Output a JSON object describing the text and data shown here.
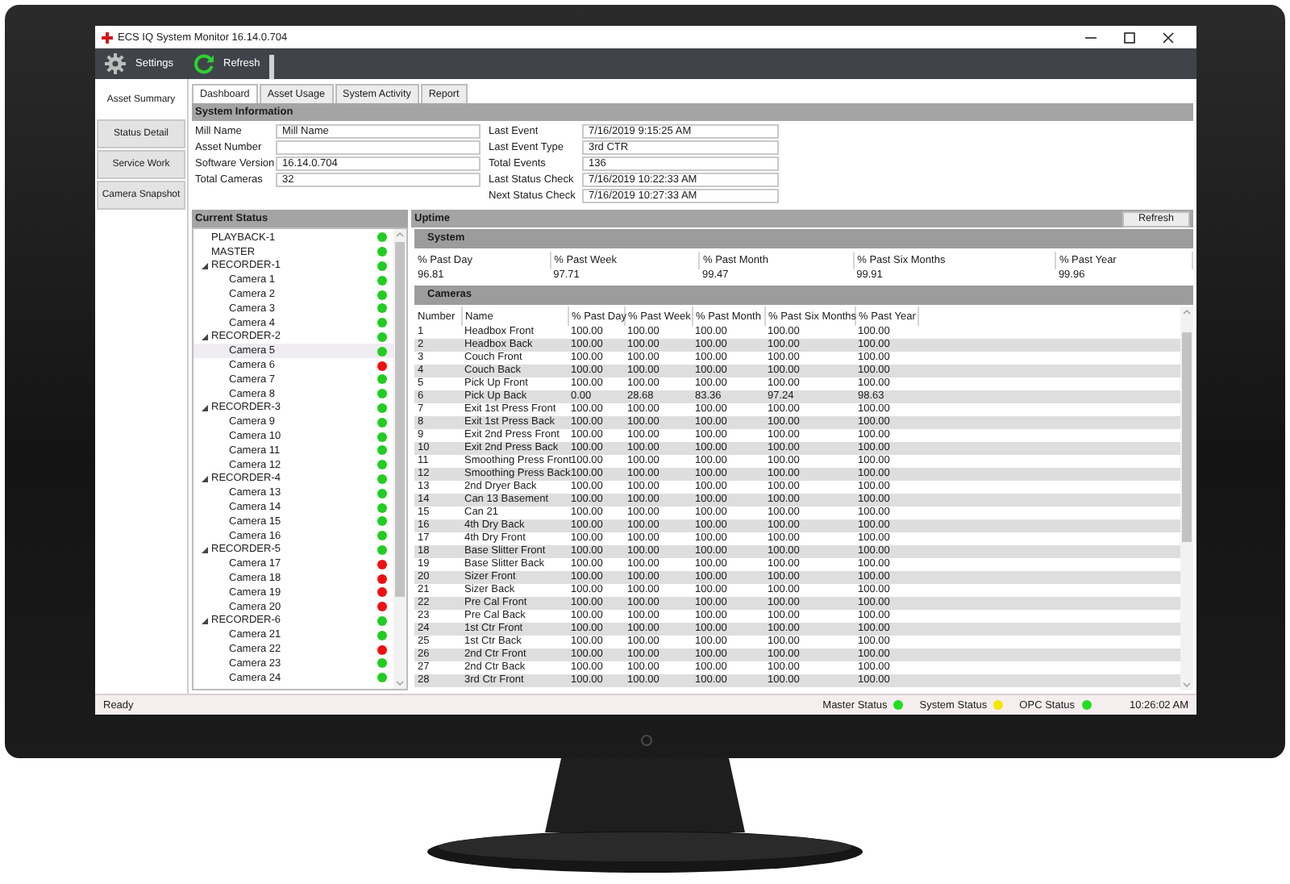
{
  "window": {
    "title": "ECS IQ System Monitor 16.14.0.704"
  },
  "toolbar": [
    {
      "label": "Settings",
      "kind": "settings"
    },
    {
      "label": "Refresh",
      "kind": "refresh"
    }
  ],
  "nav": [
    {
      "label": "Asset Summary",
      "selected": true
    },
    {
      "label": "Status Detail",
      "selected": false
    },
    {
      "label": "Service Work",
      "selected": false
    },
    {
      "label": "Camera Snapshot",
      "selected": false
    }
  ],
  "tabs": [
    {
      "label": "Dashboard",
      "selected": true
    },
    {
      "label": "Asset Usage",
      "selected": false
    },
    {
      "label": "System Activity",
      "selected": false
    },
    {
      "label": "Report",
      "selected": false
    }
  ],
  "system_information": {
    "title": "System Information",
    "fields_left": [
      {
        "label": "Mill Name",
        "value": "Mill Name"
      },
      {
        "label": "Asset Number"
      },
      {
        "label": "Software Version",
        "value": "16.14.0.704"
      },
      {
        "label": "Total Cameras",
        "value": "32"
      }
    ],
    "fields_right": [
      {
        "label": "Last Event",
        "value": "7/16/2019 9:15:25 AM"
      },
      {
        "label": "Last Event Type",
        "value": "3rd CTR"
      },
      {
        "label": "Total Events",
        "value": "136"
      },
      {
        "label": "Last Status Check",
        "value": "7/16/2019 10:22:33 AM"
      },
      {
        "label": "Next Status Check",
        "value": "7/16/2019 10:27:33 AM"
      }
    ]
  },
  "current_status": {
    "title": "Current Status",
    "items": [
      {
        "label": "PLAYBACK-1",
        "color": "#22cc22",
        "selected": false
      },
      {
        "label": "MASTER",
        "color": "#22cc22",
        "selected": false
      },
      {
        "label": "RECORDER-1",
        "color": "#22cc22",
        "selected": false,
        "expanded": true,
        "children": [
          {
            "label": "Camera 1",
            "color": "#22cc22",
            "selected": false
          },
          {
            "label": "Camera 2",
            "color": "#22cc22",
            "selected": false
          },
          {
            "label": "Camera 3",
            "color": "#22cc22",
            "selected": false
          },
          {
            "label": "Camera 4",
            "color": "#22cc22",
            "selected": false
          }
        ]
      },
      {
        "label": "RECORDER-2",
        "color": "#22cc22",
        "selected": false,
        "expanded": true,
        "children": [
          {
            "label": "Camera 5",
            "color": "#22cc22",
            "selected": true
          },
          {
            "label": "Camera 6",
            "color": "#ee1111",
            "selected": false
          },
          {
            "label": "Camera 7",
            "color": "#22cc22",
            "selected": false
          },
          {
            "label": "Camera 8",
            "color": "#22cc22",
            "selected": false
          }
        ]
      },
      {
        "label": "RECORDER-3",
        "color": "#22cc22",
        "selected": false,
        "expanded": true,
        "children": [
          {
            "label": "Camera 9",
            "color": "#22cc22",
            "selected": false
          },
          {
            "label": "Camera 10",
            "color": "#22cc22",
            "selected": false
          },
          {
            "label": "Camera 11",
            "color": "#22cc22",
            "selected": false
          },
          {
            "label": "Camera 12",
            "color": "#22cc22",
            "selected": false
          }
        ]
      },
      {
        "label": "RECORDER-4",
        "color": "#22cc22",
        "selected": false,
        "expanded": true,
        "children": [
          {
            "label": "Camera 13",
            "color": "#22cc22",
            "selected": false
          },
          {
            "label": "Camera 14",
            "color": "#22cc22",
            "selected": false
          },
          {
            "label": "Camera 15",
            "color": "#22cc22",
            "selected": false
          },
          {
            "label": "Camera 16",
            "color": "#22cc22",
            "selected": false
          }
        ]
      },
      {
        "label": "RECORDER-5",
        "color": "#22cc22",
        "selected": false,
        "expanded": true,
        "children": [
          {
            "label": "Camera 17",
            "color": "#ee1111",
            "selected": false
          },
          {
            "label": "Camera 18",
            "color": "#ee1111",
            "selected": false
          },
          {
            "label": "Camera 19",
            "color": "#ee1111",
            "selected": false
          },
          {
            "label": "Camera 20",
            "color": "#ee1111",
            "selected": false
          }
        ]
      },
      {
        "label": "RECORDER-6",
        "color": "#22cc22",
        "selected": false,
        "expanded": true,
        "children": [
          {
            "label": "Camera 21",
            "color": "#22cc22",
            "selected": false
          },
          {
            "label": "Camera 22",
            "color": "#ee1111",
            "selected": false
          },
          {
            "label": "Camera 23",
            "color": "#22cc22",
            "selected": false
          },
          {
            "label": "Camera 24",
            "color": "#22cc22",
            "selected": false
          }
        ]
      }
    ]
  },
  "uptime": {
    "title": "Uptime",
    "refresh_button": "Refresh",
    "system": {
      "title": "System",
      "columns": [
        "% Past Day",
        "% Past Week",
        "% Past Month",
        "% Past Six Months",
        "% Past Year"
      ],
      "row": [
        "96.81",
        "97.71",
        "99.47",
        "99.91",
        "99.96"
      ]
    },
    "cameras": {
      "title": "Cameras",
      "columns": [
        "Number",
        "Name",
        "% Past Day",
        "% Past Week",
        "% Past Month",
        "% Past Six Months",
        "% Past Year"
      ],
      "rows": [
        [
          "1",
          "Headbox Front",
          "100.00",
          "100.00",
          "100.00",
          "100.00",
          "100.00"
        ],
        [
          "2",
          "Headbox Back",
          "100.00",
          "100.00",
          "100.00",
          "100.00",
          "100.00"
        ],
        [
          "3",
          "Couch Front",
          "100.00",
          "100.00",
          "100.00",
          "100.00",
          "100.00"
        ],
        [
          "4",
          "Couch Back",
          "100.00",
          "100.00",
          "100.00",
          "100.00",
          "100.00"
        ],
        [
          "5",
          "Pick Up Front",
          "100.00",
          "100.00",
          "100.00",
          "100.00",
          "100.00"
        ],
        [
          "6",
          "Pick Up Back",
          "0.00",
          "28.68",
          "83.36",
          "97.24",
          "98.63"
        ],
        [
          "7",
          "Exit 1st Press Front",
          "100.00",
          "100.00",
          "100.00",
          "100.00",
          "100.00"
        ],
        [
          "8",
          "Exit 1st Press Back",
          "100.00",
          "100.00",
          "100.00",
          "100.00",
          "100.00"
        ],
        [
          "9",
          "Exit 2nd Press Front",
          "100.00",
          "100.00",
          "100.00",
          "100.00",
          "100.00"
        ],
        [
          "10",
          "Exit 2nd Press Back",
          "100.00",
          "100.00",
          "100.00",
          "100.00",
          "100.00"
        ],
        [
          "11",
          "Smoothing Press Front",
          "100.00",
          "100.00",
          "100.00",
          "100.00",
          "100.00"
        ],
        [
          "12",
          "Smoothing Press Back",
          "100.00",
          "100.00",
          "100.00",
          "100.00",
          "100.00"
        ],
        [
          "13",
          "2nd Dryer Back",
          "100.00",
          "100.00",
          "100.00",
          "100.00",
          "100.00"
        ],
        [
          "14",
          "Can 13 Basement",
          "100.00",
          "100.00",
          "100.00",
          "100.00",
          "100.00"
        ],
        [
          "15",
          "Can 21",
          "100.00",
          "100.00",
          "100.00",
          "100.00",
          "100.00"
        ],
        [
          "16",
          "4th Dry Back",
          "100.00",
          "100.00",
          "100.00",
          "100.00",
          "100.00"
        ],
        [
          "17",
          "4th Dry Front",
          "100.00",
          "100.00",
          "100.00",
          "100.00",
          "100.00"
        ],
        [
          "18",
          "Base Slitter Front",
          "100.00",
          "100.00",
          "100.00",
          "100.00",
          "100.00"
        ],
        [
          "19",
          "Base Slitter Back",
          "100.00",
          "100.00",
          "100.00",
          "100.00",
          "100.00"
        ],
        [
          "20",
          "Sizer Front",
          "100.00",
          "100.00",
          "100.00",
          "100.00",
          "100.00"
        ],
        [
          "21",
          "Sizer Back",
          "100.00",
          "100.00",
          "100.00",
          "100.00",
          "100.00"
        ],
        [
          "22",
          "Pre Cal Front",
          "100.00",
          "100.00",
          "100.00",
          "100.00",
          "100.00"
        ],
        [
          "23",
          "Pre Cal Back",
          "100.00",
          "100.00",
          "100.00",
          "100.00",
          "100.00"
        ],
        [
          "24",
          "1st Ctr Front",
          "100.00",
          "100.00",
          "100.00",
          "100.00",
          "100.00"
        ],
        [
          "25",
          "1st Ctr Back",
          "100.00",
          "100.00",
          "100.00",
          "100.00",
          "100.00"
        ],
        [
          "26",
          "2nd Ctr Front",
          "100.00",
          "100.00",
          "100.00",
          "100.00",
          "100.00"
        ],
        [
          "27",
          "2nd Ctr Back",
          "100.00",
          "100.00",
          "100.00",
          "100.00",
          "100.00"
        ],
        [
          "28",
          "3rd Ctr Front",
          "100.00",
          "100.00",
          "100.00",
          "100.00",
          "100.00"
        ]
      ]
    }
  },
  "status_bar": {
    "text": "Ready",
    "indicators": [
      {
        "label": "Master Status",
        "color": "#22dd22"
      },
      {
        "label": "System Status",
        "color": "#f2e600"
      },
      {
        "label": "OPC Status",
        "color": "#22dd22"
      }
    ],
    "time": "10:26:02 AM"
  }
}
